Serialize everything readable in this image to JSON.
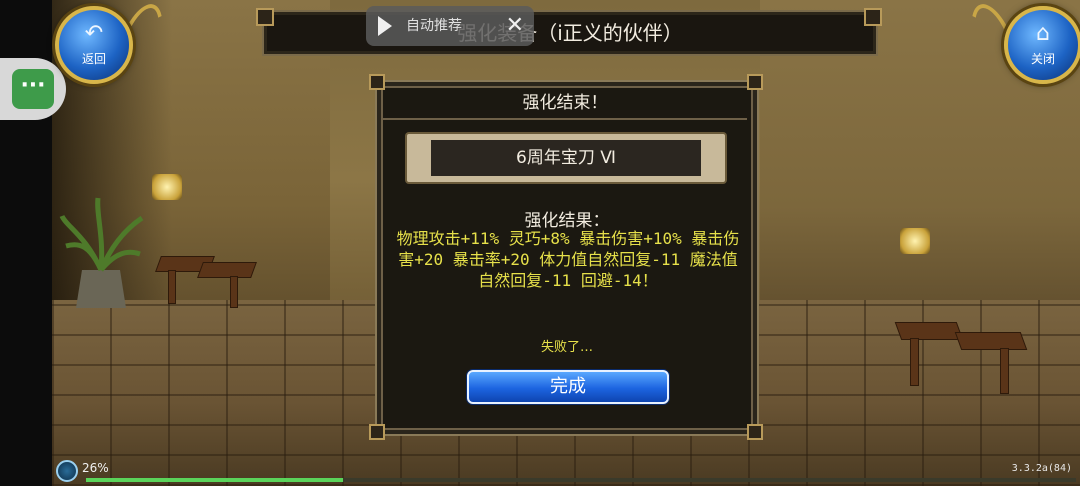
{
  "header": {
    "title": "强化装备（i正义的伙伴）",
    "back_label": "返回",
    "close_label": "关闭"
  },
  "video_overlay": {
    "text": "自动推荐",
    "close_glyph": "✕"
  },
  "floating_menu": {
    "glyph": "···"
  },
  "dialog": {
    "title": "强化结束！",
    "item_name": "6周年宝刀 Ⅵ",
    "result_label": "强化结果：",
    "result_text": "物理攻击+11% 灵巧+8% 暴击伤害+10% 暴击伤害+20 暴击率+20 体力值自然回复-11 魔法值自然回复-11 回避-14！",
    "status_text": "失败了…",
    "done_label": "完成"
  },
  "footer": {
    "loading_percent": "26%",
    "progress": 0.26,
    "version": "3.3.2a(84)"
  },
  "colors": {
    "result_yellow": "#e6e04a",
    "button_blue": "#1c64e0",
    "frame_gold": "#c9a646"
  }
}
